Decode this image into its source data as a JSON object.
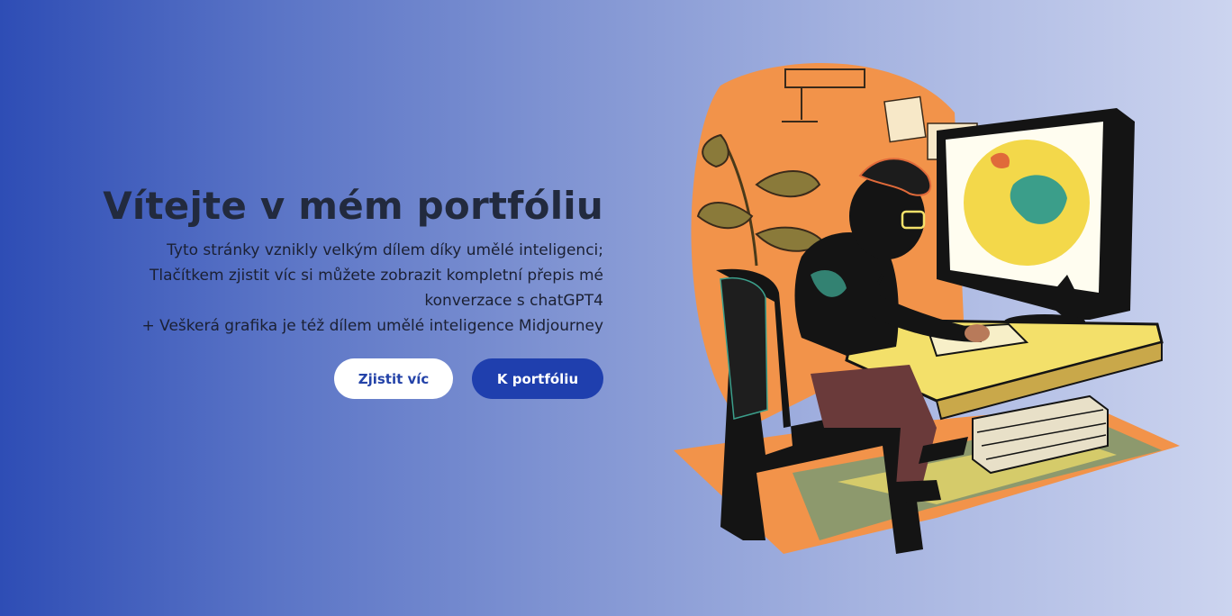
{
  "hero": {
    "title": "Vítejte v mém portfóliu",
    "description": [
      "Tyto stránky vznikly velkým dílem díky umělé inteligenci;",
      "Tlačítkem zjistit víc si můžete zobrazit kompletní přepis mé",
      "konverzace s chatGPT4",
      "+ Veškerá grafika je též dílem umělé inteligence Midjourney"
    ],
    "buttons": {
      "learn_more": "Zjistit víc",
      "portfolio": "K portfóliu"
    }
  },
  "illustration": {
    "icon": "boy-at-computer-illustration",
    "colors": {
      "orange": "#f2934a",
      "yellow": "#f3e06a",
      "dark": "#141414",
      "teal": "#3b9e8a"
    }
  },
  "colors": {
    "gradient_start": "#2e4db5",
    "gradient_end": "#ccd4ef",
    "button_primary": "#1f3fae",
    "button_secondary": "#ffffff",
    "title": "#222a3e"
  }
}
